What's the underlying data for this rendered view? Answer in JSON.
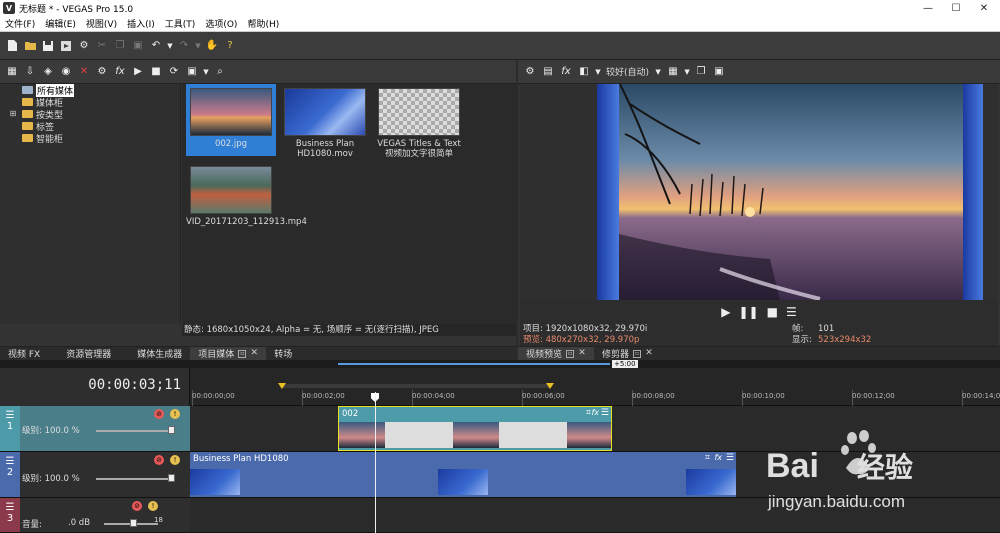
{
  "window": {
    "title": "无标题 * - VEGAS Pro 15.0",
    "app_icon": "V",
    "minimize": "—",
    "maximize": "☐",
    "close": "✕"
  },
  "menu": [
    "文件(F)",
    "编辑(E)",
    "视图(V)",
    "插入(I)",
    "工具(T)",
    "选项(O)",
    "帮助(H)"
  ],
  "media": {
    "tree": {
      "root": "所有媒体",
      "children": [
        "媒体柜",
        "按类型",
        "标签",
        "智能柜"
      ]
    },
    "thumbnails": [
      {
        "caption": "002.jpg",
        "selected": true
      },
      {
        "caption": "Business Plan HD1080.mov",
        "selected": false
      },
      {
        "caption": "VEGAS Titles & Text 视频加文字很简单",
        "selected": false
      },
      {
        "caption": "VID_20171203_112913.mp4",
        "selected": false
      }
    ],
    "status": "静态: 1680x1050x24, Alpha = 无, 场顺序 = 无(逐行扫描), JPEG"
  },
  "media_tabs": [
    "视频 FX",
    "资源管理器",
    "媒体生成器",
    "项目媒体",
    "转场"
  ],
  "preview": {
    "quality": "较好(自动)",
    "project_info": "项目: 1920x1080x32, 29.970i",
    "preview_info": "预览: 480x270x32, 29.970p",
    "frame_label": "帧:",
    "frame_value": "101",
    "display_label": "显示:",
    "display_value": "523x294x32",
    "highlight_color": "#e8896b"
  },
  "preview_tabs": [
    "视频预览",
    "修剪器"
  ],
  "timeline": {
    "timecode": "00:00:03;11",
    "loop_label": "+5:00",
    "ruler_ticks": [
      "00:00:00;00",
      "00:00:02;00",
      "00:00:04;00",
      "00:00:06;00",
      "00:00:08;00",
      "00:00:10;00",
      "00:00:12;00",
      "00:00:14;00"
    ],
    "tracks": [
      {
        "number": "1",
        "level": "级别: 100.0 %",
        "clip": "002",
        "color": "#4d9aa8"
      },
      {
        "number": "2",
        "level": "级别: 100.0 %",
        "clip": "Business Plan HD1080",
        "color": "#4a6aab"
      },
      {
        "number": "3",
        "volume_label": "音量:",
        "volume_value": ".0 dB",
        "meter": "18"
      }
    ]
  },
  "watermark": {
    "brand_left": "Bai",
    "brand_right": "经验",
    "url": "jingyan.baidu.com"
  }
}
